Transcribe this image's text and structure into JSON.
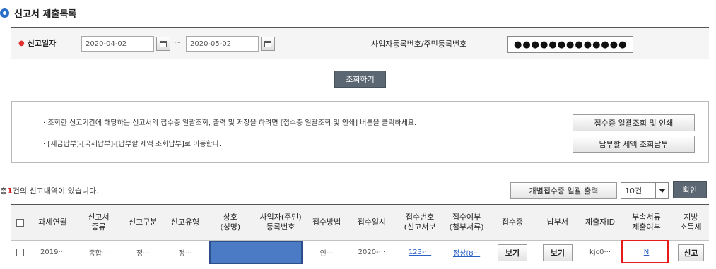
{
  "page": {
    "title": "신고서 제출목록"
  },
  "search": {
    "date_label": "신고일자",
    "date_from": "2020-04-02",
    "tilde": "~",
    "date_to": "2020-05-02",
    "bizno_label": "사업자등록번호/주민등록번호",
    "bizno_value": "●●●●●●●●●●●●●",
    "query_button": "조회하기"
  },
  "info": {
    "line1": "· 조회한 신고기간에 해당하는 신고서의 접수증 일괄조회, 출력 및 저장을 하려면 [접수증 일괄조회 및 인쇄] 버튼을 클릭하세요.",
    "line2": "· [세금납부]-[국세납부]-[납부할 세액 조회납부]로 이동한다.",
    "btn_batch_print": "접수증 일괄조회 및 인쇄",
    "btn_pay": "납부할 세액 조회납부"
  },
  "list": {
    "count_prefix": "총",
    "count": "1",
    "count_suffix": "건의 신고내역이 있습니다.",
    "btn_individual_print": "개별접수증 일괄 출력",
    "page_size": "10건",
    "btn_ok": "확인"
  },
  "table": {
    "headers": {
      "period": "과세연월",
      "form_type": "신고서\n종류",
      "report_kind": "신고구분",
      "report_type": "신고유형",
      "name": "상호\n(성명)",
      "bizno": "사업자(주민)\n등록번호",
      "method": "접수방법",
      "date": "접수일시",
      "receipt_no": "접수번호\n(신고서보",
      "attach": "접수여부\n(첨부서류)",
      "receipt": "접수증",
      "payment": "납부서",
      "submitter": "제출자ID",
      "attach_submit": "부속서류\n제출여부",
      "local_tax": "지방\n소득세"
    },
    "row": {
      "period": "2019···",
      "form_type": "종합···",
      "report_kind": "정···",
      "report_type": "정···",
      "method": "인···",
      "date": "2020-···",
      "receipt_no": "123-···",
      "attach": "정상(8···",
      "receipt_btn": "보기",
      "payment_btn": "보기",
      "submitter": "kjc0···",
      "attach_submit": "N",
      "local_tax_btn": "신고"
    }
  },
  "colors": {
    "accent": "#2a6fc9",
    "dark_button": "#5b6773",
    "highlight": "#e81b1b",
    "masked_cell": "#4a7bc4",
    "link": "#2a5fc4"
  }
}
